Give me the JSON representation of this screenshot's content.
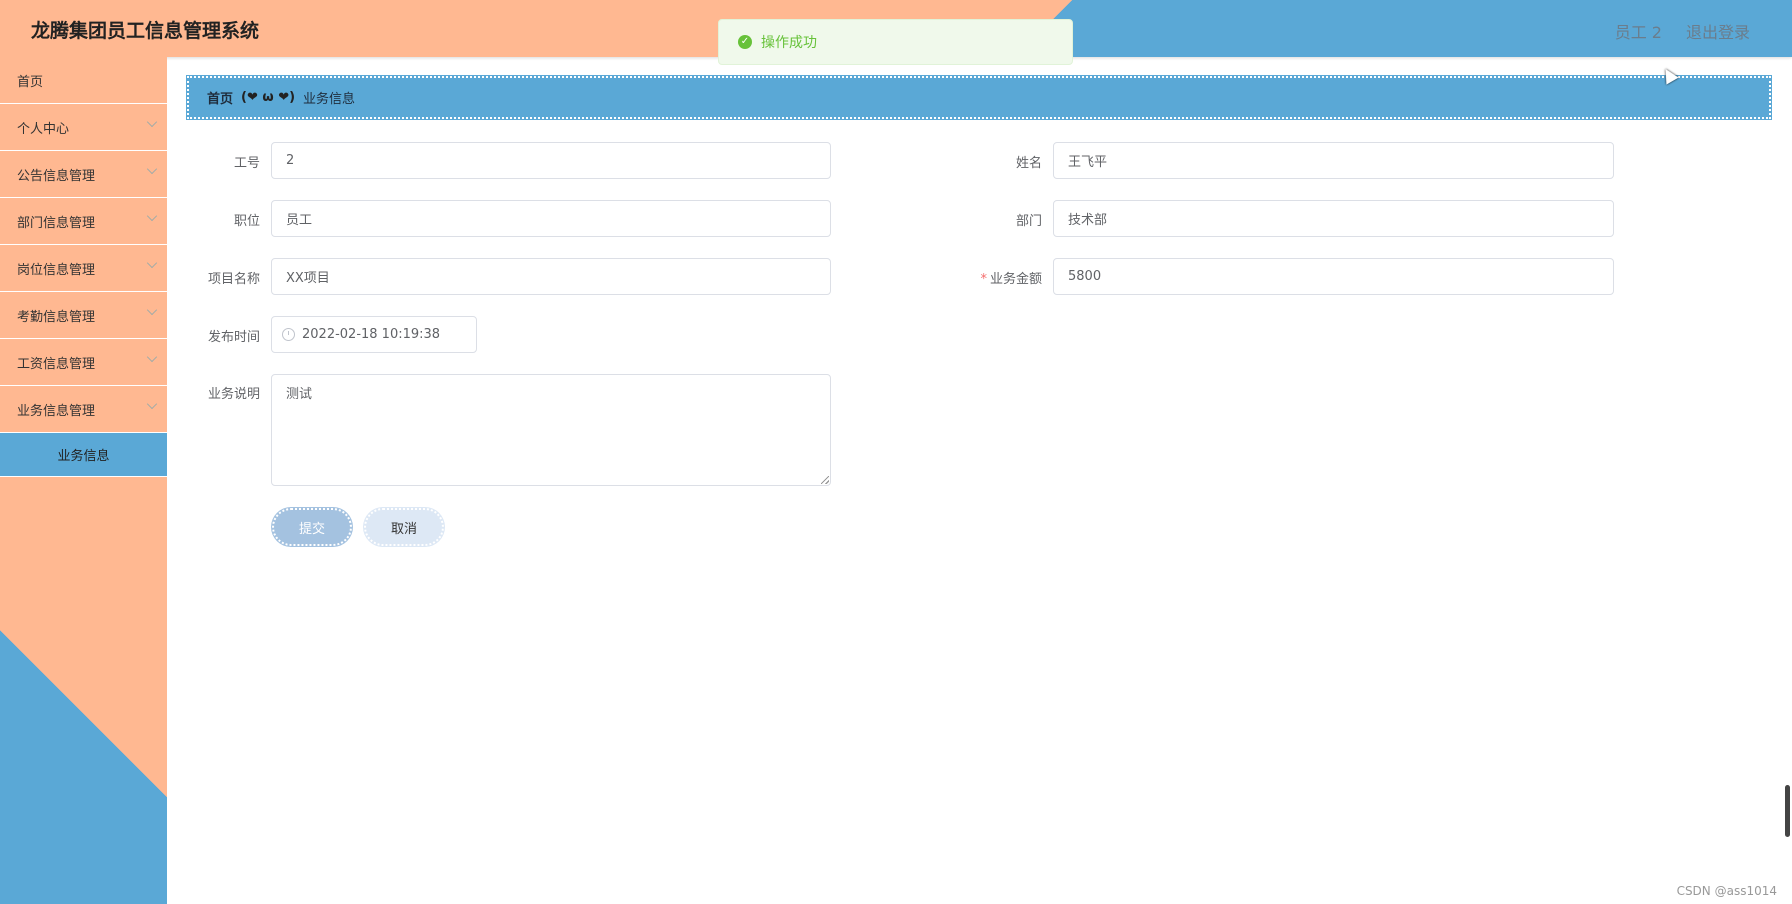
{
  "header": {
    "title": "龙腾集团员工信息管理系统",
    "user": "员工 2",
    "logout": "退出登录"
  },
  "toast": {
    "message": "操作成功",
    "icon": "check-circle-icon"
  },
  "sidebar": {
    "items": [
      {
        "label": "首页"
      },
      {
        "label": "个人中心"
      },
      {
        "label": "公告信息管理"
      },
      {
        "label": "部门信息管理"
      },
      {
        "label": "岗位信息管理"
      },
      {
        "label": "考勤信息管理"
      },
      {
        "label": "工资信息管理"
      },
      {
        "label": "业务信息管理"
      }
    ],
    "active_sub": "业务信息"
  },
  "breadcrumb": {
    "home": "首页",
    "separator": "(❤ ω ❤)",
    "current": "业务信息"
  },
  "form": {
    "employee_id": {
      "label": "工号",
      "value": "2"
    },
    "name": {
      "label": "姓名",
      "value": "王飞平"
    },
    "position": {
      "label": "职位",
      "value": "员工"
    },
    "department": {
      "label": "部门",
      "value": "技术部"
    },
    "project": {
      "label": "项目名称",
      "value": "XX项目"
    },
    "amount": {
      "label": "业务金额",
      "value": "5800",
      "required": "*"
    },
    "publish_time": {
      "label": "发布时间",
      "value": "2022-02-18 10:19:38"
    },
    "description": {
      "label": "业务说明",
      "value": "测试"
    },
    "submit": "提交",
    "cancel": "取消"
  },
  "watermark": "CSDN @ass1014",
  "colors": {
    "peach": "#ffb891",
    "blue": "#5aa8d6",
    "success": "#67c23a"
  }
}
